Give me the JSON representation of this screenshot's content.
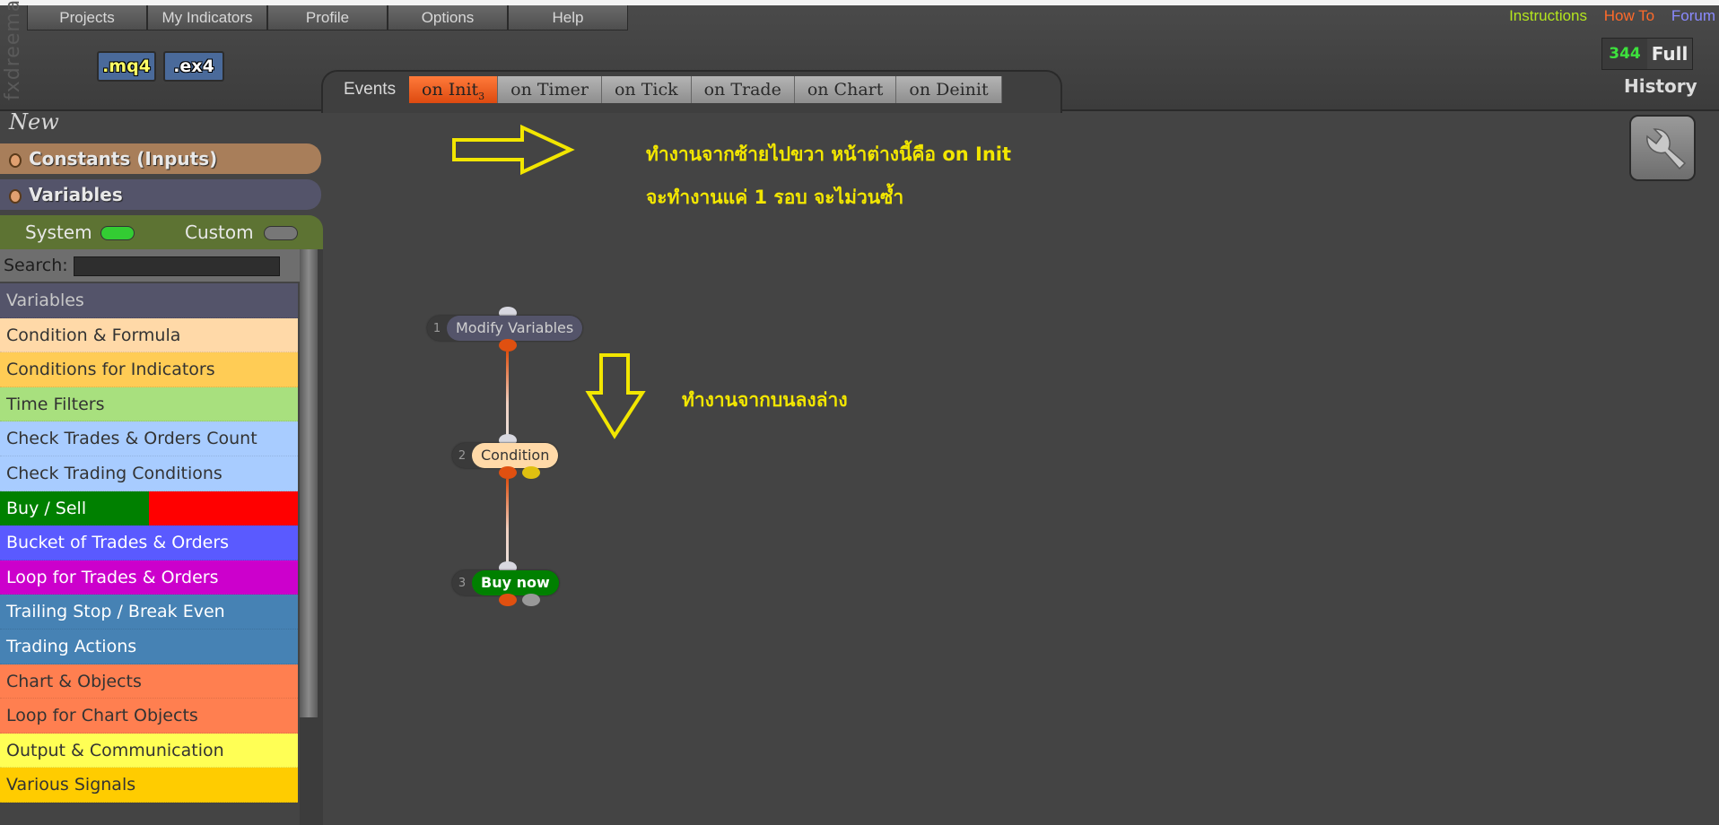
{
  "app": {
    "brand": "fxdreema"
  },
  "menu": [
    "Projects",
    "My Indicators",
    "Profile",
    "Options",
    "Help"
  ],
  "file_buttons": {
    "mq4": ".mq4",
    "ex4": ".ex4"
  },
  "top_links": [
    {
      "label": "Instructions",
      "color": "#b4e61e"
    },
    {
      "label": "How To",
      "color": "#ff6a2a"
    },
    {
      "label": "Forum",
      "color": "#8a8aff"
    }
  ],
  "counter": {
    "value": "344",
    "label": "Full"
  },
  "history_label": "History",
  "events": {
    "label": "Events",
    "tabs": [
      {
        "label": "on Init",
        "badge": "3",
        "active": true
      },
      {
        "label": "on Timer",
        "active": false
      },
      {
        "label": "on Tick",
        "active": false
      },
      {
        "label": "on Trade",
        "active": false
      },
      {
        "label": "on Chart",
        "active": false
      },
      {
        "label": "on Deinit",
        "active": false
      }
    ]
  },
  "sidebar": {
    "new_label": "New",
    "constants_label": "Constants (Inputs)",
    "variables_label": "Variables",
    "system_label": "System",
    "custom_label": "Custom",
    "search_label": "Search:",
    "search_value": "",
    "categories": [
      {
        "label": "Variables",
        "bg": "#54546a",
        "fg": "#c8c8c8"
      },
      {
        "label": "Condition & Formula",
        "bg": "#ffd9a8",
        "fg": "#333"
      },
      {
        "label": "Conditions for Indicators",
        "bg": "#ffcc55",
        "fg": "#333"
      },
      {
        "label": "Time Filters",
        "bg": "#a8e07e",
        "fg": "#333"
      },
      {
        "label": "Check Trades & Orders Count",
        "bg": "#a8ccff",
        "fg": "#333"
      },
      {
        "label": "Check Trading Conditions",
        "bg": "#a8ccff",
        "fg": "#333"
      },
      {
        "label": "Buy / Sell",
        "bg": "#008000",
        "bg2": "#ff0000",
        "fg": "#fff"
      },
      {
        "label": "Bucket of Trades & Orders",
        "bg": "#5a5aff",
        "fg": "#fff"
      },
      {
        "label": "Loop for Trades & Orders",
        "bg": "#cc00cc",
        "fg": "#fff"
      },
      {
        "label": "Trailing Stop / Break Even",
        "bg": "#4682b4",
        "fg": "#fff"
      },
      {
        "label": "Trading Actions",
        "bg": "#4682b4",
        "fg": "#fff"
      },
      {
        "label": "Chart & Objects",
        "bg": "#ff7f50",
        "fg": "#333"
      },
      {
        "label": "Loop for Chart Objects",
        "bg": "#ff7f50",
        "fg": "#333"
      },
      {
        "label": "Output & Communication",
        "bg": "#ffff55",
        "fg": "#333"
      },
      {
        "label": "Various Signals",
        "bg": "#ffcc00",
        "fg": "#333"
      }
    ]
  },
  "canvas": {
    "note_right": [
      "ทำงานจากซ้ายไปขวา หน้าต่างนี้คือ on Init",
      "จะทำงานแค่ 1 รอบ จะไม่วนซ้ำ"
    ],
    "note_down": "ทำงานจากบนลงล่าง",
    "blocks": [
      {
        "index": "1",
        "label": "Modify Variables",
        "bg": "#54546a",
        "fg": "#d0d0d0"
      },
      {
        "index": "2",
        "label": "Condition",
        "bg": "#ffd9a8",
        "fg": "#333"
      },
      {
        "index": "3",
        "label": "Buy now",
        "bg": "#008000",
        "fg": "#fff"
      }
    ]
  }
}
